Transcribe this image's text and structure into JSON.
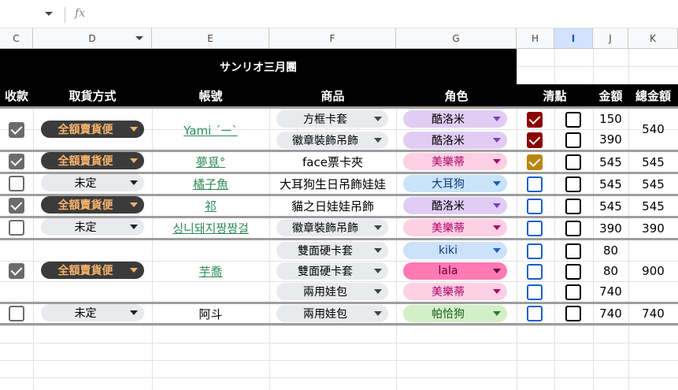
{
  "formula_bar": {
    "fx": "fx"
  },
  "columns": [
    "C",
    "D",
    "E",
    "F",
    "G",
    "H",
    "I",
    "J",
    "K"
  ],
  "sheet_title": "サンリオ三月團",
  "headers": {
    "paid": "收款",
    "pickup": "取貨方式",
    "account": "帳號",
    "product": "商品",
    "character": "角色",
    "check": "清點",
    "amount": "金額",
    "total": "總金額"
  },
  "pickup_options": {
    "full": "全額賣貨便",
    "undecided": "未定"
  },
  "rows": [
    {
      "account": "Yami ´ㅡ`",
      "total": "540",
      "items": [
        {
          "product": "方框卡套",
          "character": "酷洛米",
          "amount": "150"
        },
        {
          "product": "徽章裝飾吊飾",
          "character": "酷洛米",
          "amount": "390"
        }
      ]
    },
    {
      "account": "夢覓°",
      "total": "545",
      "items": [
        {
          "product": "face票卡夾",
          "character": "美樂蒂",
          "amount": "545"
        }
      ]
    },
    {
      "account": "橘子魚",
      "total": "545",
      "items": [
        {
          "product": "大耳狗生日吊飾娃娃",
          "character": "大耳狗",
          "amount": "545"
        }
      ]
    },
    {
      "account": "祁",
      "total": "545",
      "items": [
        {
          "product": "貓之日娃娃吊飾",
          "character": "酷洛米",
          "amount": "545"
        }
      ]
    },
    {
      "account": "싱니돼지짱짱걸",
      "total": "390",
      "items": [
        {
          "product": "徽章裝飾吊飾",
          "character": "美樂蒂",
          "amount": "390"
        }
      ]
    },
    {
      "account": "芋喬",
      "total": "900",
      "items": [
        {
          "product": "雙面硬卡套",
          "character": "kiki",
          "amount": "80"
        },
        {
          "product": "雙面硬卡套",
          "character": "lala",
          "amount": "80"
        },
        {
          "product": "兩用娃包",
          "character": "美樂蒂",
          "amount": "740"
        }
      ]
    },
    {
      "account": "阿斗",
      "total": "740",
      "items": [
        {
          "product": "兩用娃包",
          "character": "帕恰狗",
          "amount": "740"
        }
      ]
    }
  ],
  "colors": {
    "kuromi": "#e1cdf4",
    "melody": "#fdd0e3",
    "cinnamoroll": "#c9e3f8",
    "kiki": "#cce1fb",
    "lala": "#ff79b4",
    "pochacco": "#d3efc8",
    "link": "#2e8b57",
    "check_red": "#8b0000",
    "check_gold": "#b8860b",
    "check_blue": "#1a5fcc"
  }
}
